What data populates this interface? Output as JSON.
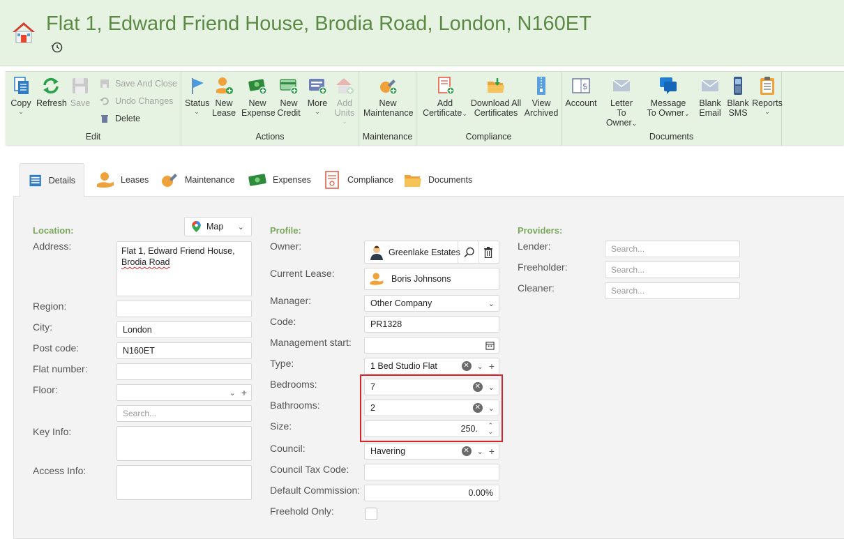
{
  "header": {
    "title": "Flat 1, Edward Friend House, Brodia Road, London, N160ET"
  },
  "ribbon": {
    "edit": {
      "label": "Edit",
      "copy": "Copy",
      "refresh": "Refresh",
      "save": "Save",
      "save_and_close": "Save And Close",
      "undo_changes": "Undo Changes",
      "delete": "Delete"
    },
    "actions": {
      "label": "Actions",
      "status": "Status",
      "new_lease_1": "New",
      "new_lease_2": "Lease",
      "new_expense_1": "New",
      "new_expense_2": "Expense",
      "new_credit_1": "New",
      "new_credit_2": "Credit",
      "more": "More",
      "add_units_1": "Add",
      "add_units_2": "Units"
    },
    "maintenance": {
      "label": "Maintenance",
      "new_maintenance_1": "New",
      "new_maintenance_2": "Maintenance"
    },
    "compliance": {
      "label": "Compliance",
      "add_certificate_1": "Add",
      "add_certificate_2": "Certificate",
      "download_all_1": "Download All",
      "download_all_2": "Certificates",
      "view_archived_1": "View",
      "view_archived_2": "Archived"
    },
    "documents": {
      "label": "Documents",
      "account": "Account",
      "letter_1": "Letter",
      "letter_2": "To Owner",
      "message_1": "Message",
      "message_2": "To Owner",
      "blank_email_1": "Blank",
      "blank_email_2": "Email",
      "blank_sms_1": "Blank",
      "blank_sms_2": "SMS",
      "reports": "Reports"
    }
  },
  "tabs": [
    "Details",
    "Leases",
    "Maintenance",
    "Expenses",
    "Compliance",
    "Documents"
  ],
  "location": {
    "title": "Location:",
    "map_button": "Map",
    "address_label": "Address:",
    "address_line1": "Flat 1, Edward Friend House,",
    "address_line2": "Brodia Road",
    "region_label": "Region:",
    "region_value": "",
    "city_label": "City:",
    "city_value": "London",
    "postcode_label": "Post code:",
    "postcode_value": "N160ET",
    "flat_number_label": "Flat number:",
    "flat_number_value": "",
    "floor_label": "Floor:",
    "floor_search_placeholder": "Search...",
    "key_info_label": "Key Info:",
    "access_info_label": "Access Info:"
  },
  "profile": {
    "title": "Profile:",
    "owner_label": "Owner:",
    "owner_value": "Greenlake Estates",
    "current_lease_label": "Current Lease:",
    "current_lease_value": "Boris Johnsons",
    "manager_label": "Manager:",
    "manager_value": "Other Company",
    "code_label": "Code:",
    "code_value": "PR1328",
    "management_start_label": "Management start:",
    "management_start_value": "",
    "type_label": "Type:",
    "type_value": "1 Bed Studio Flat",
    "bedrooms_label": "Bedrooms:",
    "bedrooms_value": "7",
    "bathrooms_label": "Bathrooms:",
    "bathrooms_value": "2",
    "size_label": "Size:",
    "size_value": "250.",
    "council_label": "Council:",
    "council_value": "Havering",
    "council_tax_label": "Council Tax Code:",
    "council_tax_value": "",
    "commission_label": "Default Commission:",
    "commission_value": "0.00%",
    "freehold_label": "Freehold Only:",
    "freehold_checked": false
  },
  "providers": {
    "title": "Providers:",
    "lender_label": "Lender:",
    "freeholder_label": "Freeholder:",
    "cleaner_label": "Cleaner:",
    "search_placeholder": "Search..."
  },
  "colors": {
    "header_bg": "#e6f2e2",
    "title_green": "#5b8a44",
    "section_green": "#7aa75a",
    "highlight_red": "#d9222a"
  }
}
